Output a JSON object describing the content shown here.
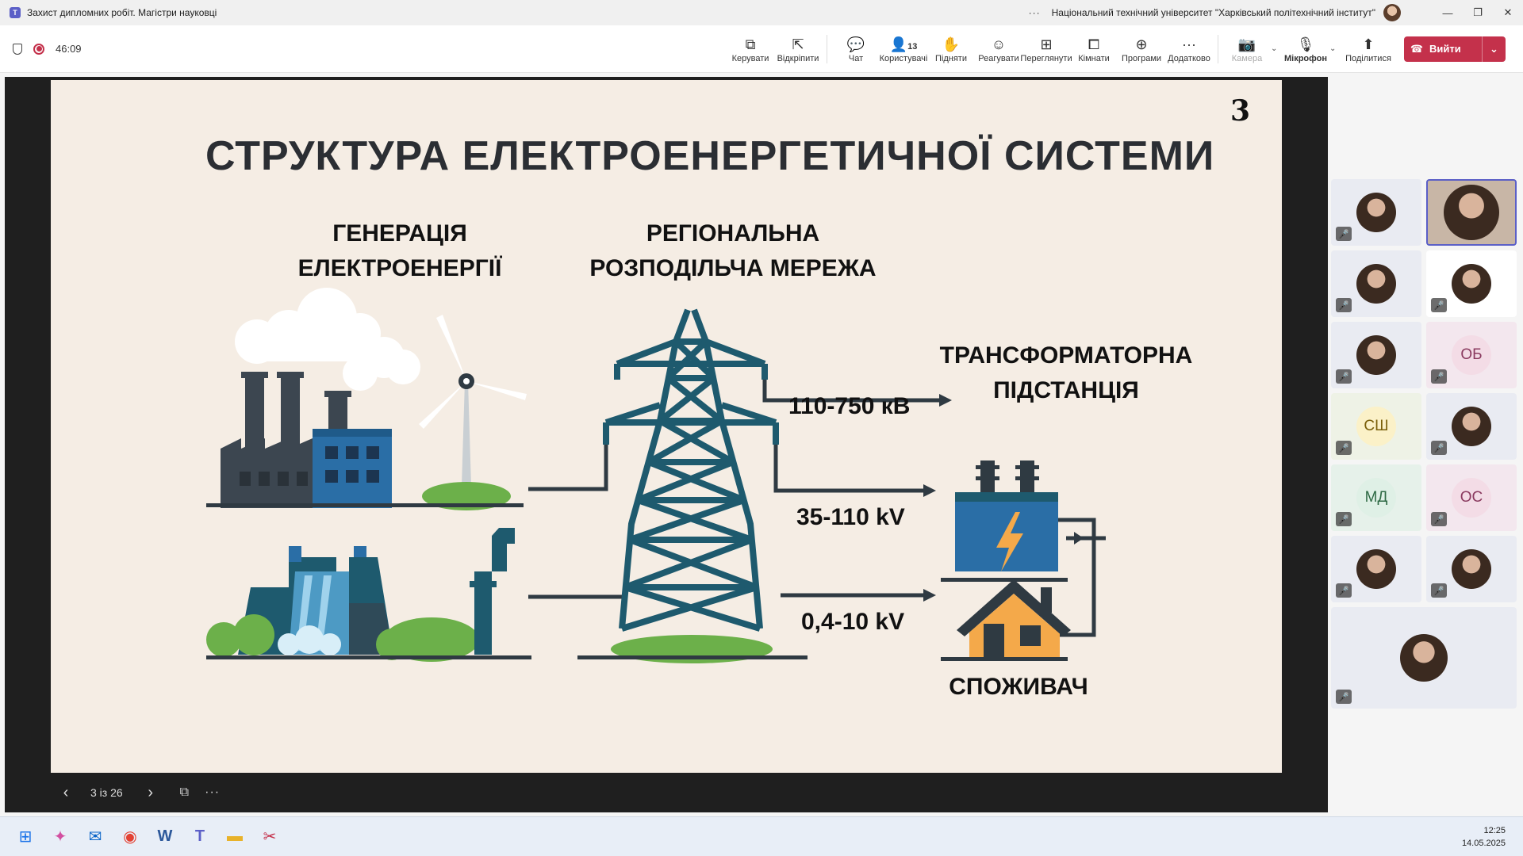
{
  "window": {
    "title": "Захист дипломних робіт. Магістри науковці",
    "more": "···",
    "organization": "Національний технічний університет \"Харківський політехнічний інститут\"",
    "app_icon": "teams-icon"
  },
  "call": {
    "timer": "46:09",
    "toolbar": {
      "manage": "Керувати",
      "popout": "Відкріпити",
      "chat": "Чат",
      "people": "Користувачі",
      "people_count": "13",
      "raise": "Підняти",
      "react": "Реагувати",
      "view": "Переглянути",
      "rooms": "Кімнати",
      "apps": "Програми",
      "more": "Додатково",
      "camera": "Камера",
      "mic": "Мікрофон",
      "share": "Поділитися",
      "leave": "Вийти"
    }
  },
  "slide": {
    "number": "3",
    "title": "СТРУКТУРА ЕЛЕКТРОЕНЕРГЕТИЧНОЇ СИСТЕМИ",
    "generation_line1": "ГЕНЕРАЦІЯ",
    "generation_line2": "ЕЛЕКТРОЕНЕРГІЇ",
    "network_line1": "РЕГІОНАЛЬНА",
    "network_line2": "РОЗПОДІЛЬЧА МЕРЕЖА",
    "substation_line1": "ТРАНСФОРМАТОРНА",
    "substation_line2": "ПІДСТАНЦІЯ",
    "voltage_high": "110-750 кВ",
    "voltage_mid": "35-110 kV",
    "voltage_low": "0,4-10 kV",
    "consumer": "СПОЖИВАЧ",
    "colors": {
      "background": "#f5ede4",
      "tower": "#1e5a6e",
      "factory": "#3c4650",
      "blue": "#2a6ea6",
      "green": "#6cb04a",
      "house": "#f4a94a"
    }
  },
  "slidebar": {
    "counter": "3 із 26"
  },
  "participants": [
    {
      "initials": "",
      "kind": "photo"
    },
    {
      "initials": "",
      "kind": "photo",
      "active": true
    },
    {
      "initials": "",
      "kind": "photo"
    },
    {
      "initials": "",
      "kind": "photo"
    },
    {
      "initials": "",
      "kind": "photo"
    },
    {
      "initials": "ОБ",
      "kind": "initials",
      "color": "#f3dce6",
      "text": "#8a3a5f"
    },
    {
      "initials": "СШ",
      "kind": "initials",
      "color": "#fbf1c8",
      "text": "#7a5f0a"
    },
    {
      "initials": "",
      "kind": "photo"
    },
    {
      "initials": "МД",
      "kind": "initials",
      "color": "#dff0e6",
      "text": "#2f6a45"
    },
    {
      "initials": "ОС",
      "kind": "initials",
      "color": "#f3dce6",
      "text": "#8a3a5f"
    },
    {
      "initials": "",
      "kind": "photo"
    },
    {
      "initials": "",
      "kind": "photo"
    },
    {
      "initials": "",
      "kind": "photo"
    }
  ],
  "taskbar": {
    "time": "12:25",
    "date": "14.05.2025",
    "apps": [
      "windows-start-icon",
      "copilot-icon",
      "outlook-icon",
      "chrome-icon",
      "word-icon",
      "teams-icon",
      "file-explorer-icon",
      "snipping-tool-icon"
    ]
  }
}
